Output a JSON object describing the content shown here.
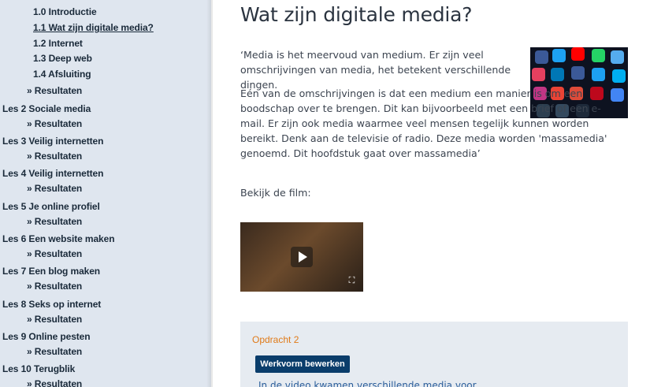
{
  "sidebar": {
    "items": [
      {
        "label": "1.0 Introductie"
      },
      {
        "label": "1.1 Wat zijn digitale media?"
      },
      {
        "label": "1.2 Internet"
      },
      {
        "label": "1.3 Deep web"
      },
      {
        "label": "1.4 Afsluiting"
      },
      {
        "label": "» Resultaten"
      },
      {
        "label": "Les 2 Sociale media"
      },
      {
        "label": "» Resultaten"
      },
      {
        "label": "Les 3 Veilig internetten"
      },
      {
        "label": "» Resultaten"
      },
      {
        "label": "Les 4 Veilig internetten"
      },
      {
        "label": "» Resultaten"
      },
      {
        "label": "Les 5 Je online profiel"
      },
      {
        "label": "» Resultaten"
      },
      {
        "label": "Les 6 Een website maken"
      },
      {
        "label": "» Resultaten"
      },
      {
        "label": "Les 7 Een blog maken"
      },
      {
        "label": "» Resultaten"
      },
      {
        "label": "Les 8 Seks op internet"
      },
      {
        "label": "» Resultaten"
      },
      {
        "label": "Les 9 Online pesten"
      },
      {
        "label": "» Resultaten"
      },
      {
        "label": "Les 10 Terugblik"
      },
      {
        "label": "» Resultaten"
      }
    ]
  },
  "main": {
    "title": "Wat zijn digitale media?",
    "paragraph1": "‘Media is het meervoud van medium. Er zijn veel omschrijvingen van media, het betekent verschillende dingen.",
    "paragraph2": "Eén van de omschrijvingen is dat een medium een manier is om een boodschap over te brengen. Dit kan bijvoorbeeld met een brief of een e-mail. Er zijn ook media waarmee veel mensen tegelijk kunnen worden bereikt. Denk aan de televisie of radio. Deze media worden 'massamedia' genoemd. Dit hoofdstuk gaat over massamedia’",
    "paragraph3": "Bekijk de film:",
    "assignment": {
      "title": "Opdracht 2",
      "button_label": "Werkvorm bewerken",
      "text": "In de video kwamen verschillende media voor"
    }
  },
  "colors": {
    "sidebar_bg": "#dfe6ef",
    "assignment_title": "#e07a18",
    "button_bg": "#0a3d6b",
    "link": "#2a5d9a"
  },
  "icons": [
    "play-icon",
    "expand-icon"
  ]
}
